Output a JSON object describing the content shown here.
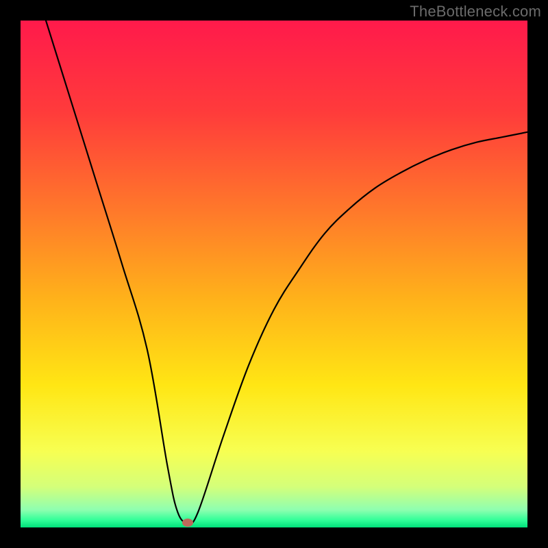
{
  "watermark": "TheBottleneck.com",
  "chart_data": {
    "type": "line",
    "title": "",
    "xlabel": "",
    "ylabel": "",
    "xlim": [
      0,
      100
    ],
    "ylim": [
      0,
      100
    ],
    "grid": false,
    "legend": false,
    "series": [
      {
        "name": "curve",
        "x": [
          5,
          10,
          15,
          20,
          25,
          29,
          31,
          33,
          35,
          40,
          45,
          50,
          55,
          60,
          65,
          70,
          75,
          80,
          85,
          90,
          95,
          100
        ],
        "y": [
          100,
          84,
          68,
          52,
          35,
          12,
          3,
          1,
          3,
          18,
          32,
          43,
          51,
          58,
          63,
          67,
          70,
          72.5,
          74.5,
          76,
          77,
          78
        ]
      }
    ],
    "marker": {
      "x": 33,
      "y": 1
    },
    "gradient_stops": [
      {
        "offset": 0.0,
        "color": "#ff1a4b"
      },
      {
        "offset": 0.18,
        "color": "#ff3b3b"
      },
      {
        "offset": 0.38,
        "color": "#ff7a2a"
      },
      {
        "offset": 0.55,
        "color": "#ffb21a"
      },
      {
        "offset": 0.72,
        "color": "#ffe614"
      },
      {
        "offset": 0.85,
        "color": "#f7ff52"
      },
      {
        "offset": 0.92,
        "color": "#d4ff7a"
      },
      {
        "offset": 0.965,
        "color": "#8fffb0"
      },
      {
        "offset": 0.985,
        "color": "#33ff99"
      },
      {
        "offset": 1.0,
        "color": "#00e07a"
      }
    ]
  }
}
